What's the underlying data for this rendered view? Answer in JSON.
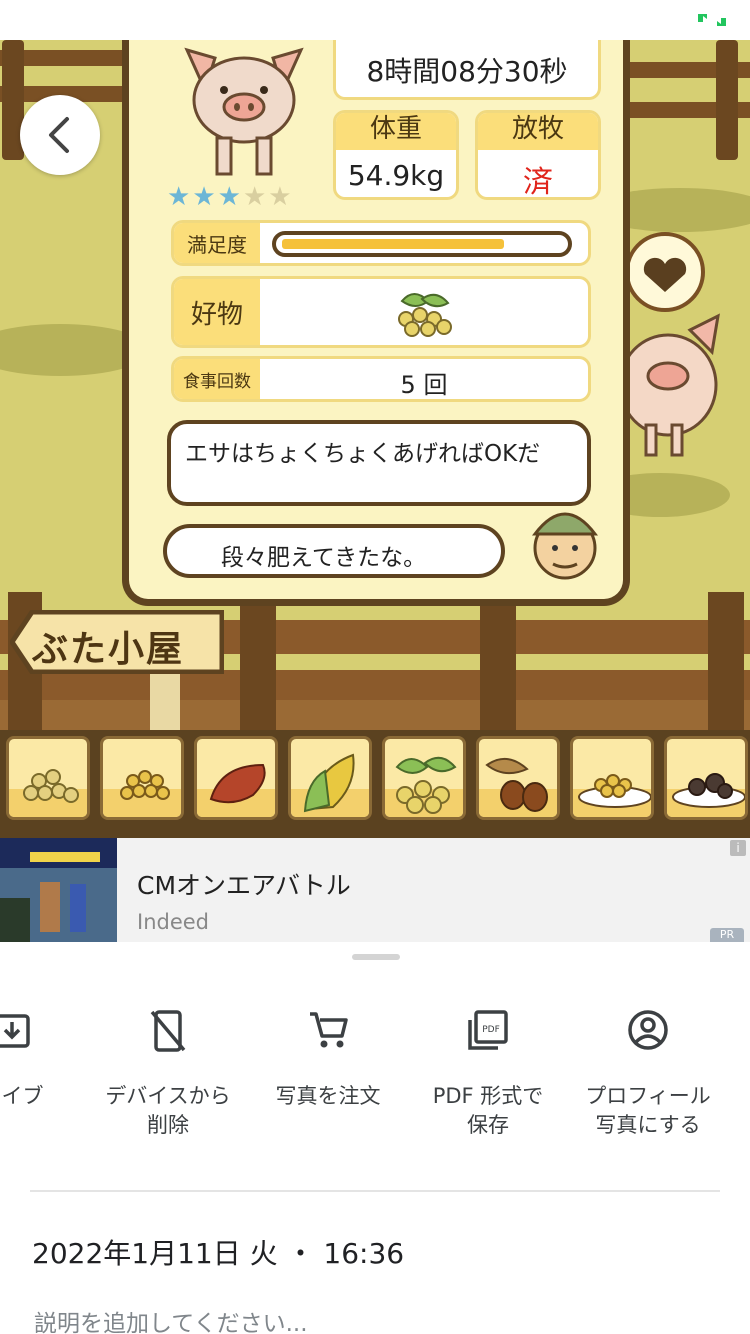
{
  "game": {
    "timer": "8時間08分30秒",
    "weight_label": "体重",
    "weight_value": "54.9kg",
    "graze_label": "放牧",
    "graze_value": "済",
    "stars": 3,
    "stars_total": 5,
    "satisfaction_label": "満足度",
    "satisfaction_level": 0.78,
    "favorite_label": "好物",
    "favorite_icon": "soybean-icon",
    "meals_label": "食事回数",
    "meals_value": "5 回",
    "bubble_pig": "エサはちょくちょくあげればOKだ",
    "bubble_farmer": "段々肥えてきたな。",
    "sign": "ぶた小屋",
    "feed_items": [
      "grain-icon",
      "yellow-grain-icon",
      "sweet-potato-icon",
      "corn-icon",
      "soybean-icon",
      "acorn-icon",
      "grain-plate-icon",
      "meatball-plate-icon"
    ],
    "colors": {
      "panel": "#fbf4c2",
      "frame": "#5e4320",
      "label": "#fbde7a",
      "red": "#e0241b",
      "bar": "#f5c13a"
    }
  },
  "ad": {
    "title": "CMオンエアバトル",
    "source": "Indeed",
    "info": "i",
    "pr": "PR"
  },
  "sheet": {
    "actions": [
      {
        "label": "カイブ",
        "icon": "archive-icon"
      },
      {
        "label": "デバイスから\n削除",
        "icon": "phone-off-icon"
      },
      {
        "label": "写真を注文",
        "icon": "cart-icon"
      },
      {
        "label": "PDF 形式で\n保存",
        "icon": "pdf-icon"
      },
      {
        "label": "プロフィール\n写真にする",
        "icon": "account-icon"
      }
    ],
    "date": "2022年1月11日 火 ・ 16:36",
    "description_placeholder": "説明を追加してください..."
  }
}
